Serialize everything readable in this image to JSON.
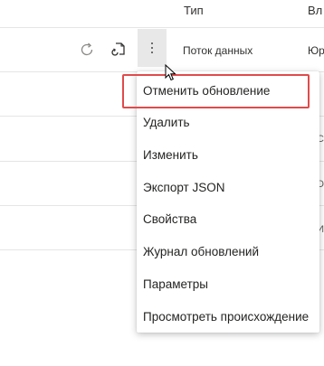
{
  "table": {
    "columns": [
      "Тип",
      "Вл"
    ],
    "row1": {
      "type": "Поток данных",
      "owner": "Юр"
    }
  },
  "row_glyphs": [
    "С",
    "Ю",
    "И"
  ],
  "menu": {
    "items": [
      {
        "label": "Отменить обновление"
      },
      {
        "label": "Удалить"
      },
      {
        "label": "Изменить"
      },
      {
        "label": "Экспорт JSON"
      },
      {
        "label": "Свойства"
      },
      {
        "label": "Журнал обновлений"
      },
      {
        "label": "Параметры"
      },
      {
        "label": "Просмотреть происхождение"
      }
    ]
  },
  "icons": [
    "refresh-icon",
    "schedule-refresh-icon",
    "more-options-icon",
    "mouse-pointer-icon"
  ],
  "colors": {
    "highlight": "#e04b4b",
    "more_button_bg": "#e8e8e8"
  }
}
